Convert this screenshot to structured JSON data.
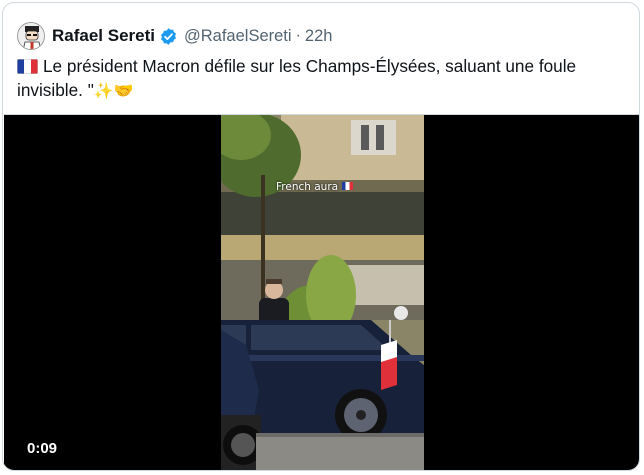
{
  "tweet": {
    "author_name": "Rafael Sereti",
    "handle": "@RafaelSereti",
    "separator": "·",
    "time": "22h",
    "verified_icon": "verified-badge-icon",
    "flag_icon": "france-flag-icon",
    "text": "Le président Macron défile sur les Champs-Élysées, saluant une foule invisible. \"",
    "trailing_emojis": {
      "sparkles": "✨",
      "handshake": "🤝"
    }
  },
  "media": {
    "type": "video",
    "timestamp": "0:09",
    "caption": "French aura",
    "caption_flag_icon": "france-flag-icon"
  },
  "colors": {
    "verified": "#1d9bf0",
    "secondary_text": "#536471",
    "border": "#cfd9de"
  }
}
